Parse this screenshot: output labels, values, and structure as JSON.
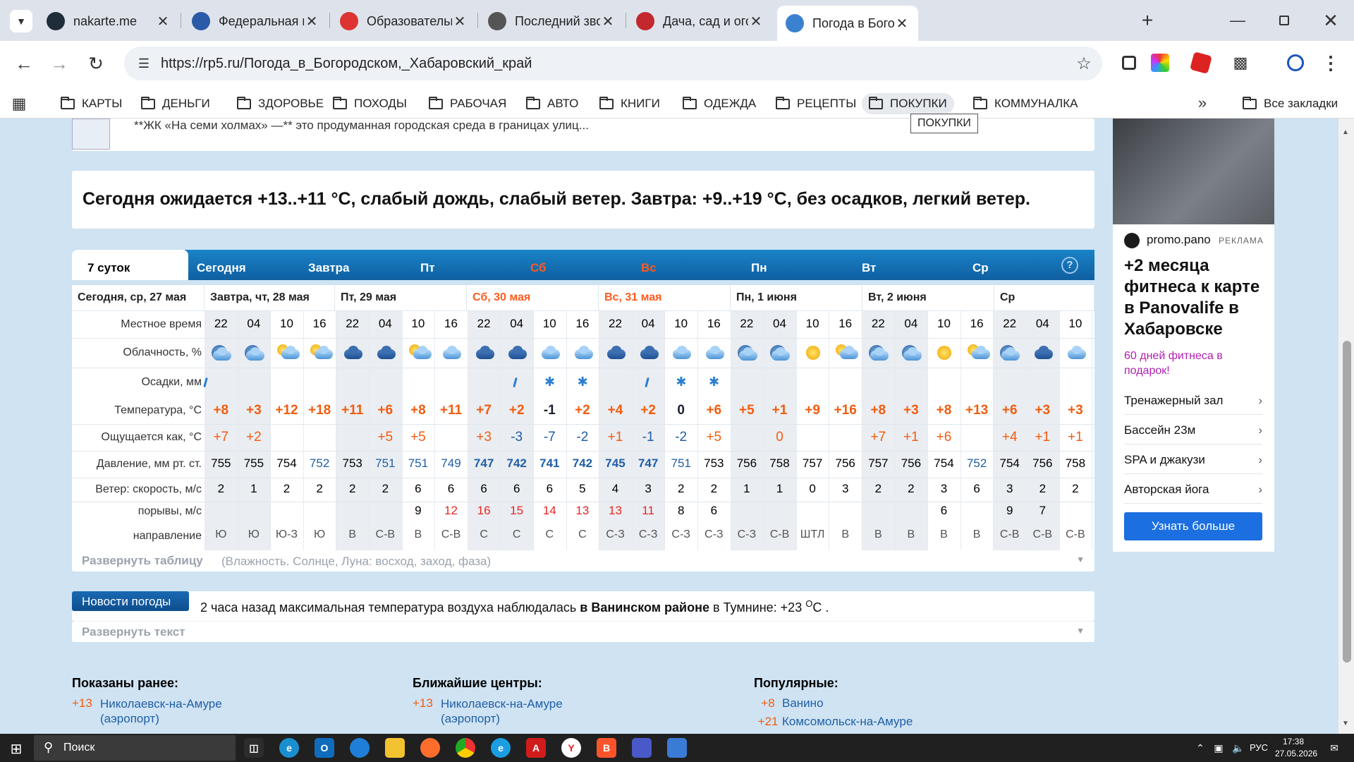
{
  "tabs": [
    {
      "title": "nakarte.me",
      "icon": "nakarte-icon",
      "color": "#1f2d3a"
    },
    {
      "title": "Федеральная налог",
      "icon": "nalog-icon",
      "color": "#2a5aa8"
    },
    {
      "title": "Образовательные п",
      "icon": "edu-icon",
      "color": "#d33"
    },
    {
      "title": "Последний звонок",
      "icon": "globe-icon",
      "color": "#555"
    },
    {
      "title": "Дача, сад и огород",
      "icon": "dacha-icon",
      "color": "#c2282d"
    },
    {
      "title": "Погода в Богородс",
      "icon": "rp5-icon",
      "color": "#3a82d0"
    }
  ],
  "url": "https://rp5.ru/Погода_в_Богородском,_Хабаровский_край",
  "bookmarks": [
    "КАРТЫ",
    "ДЕНЬГИ",
    "ЗДОРОВЬЕ",
    "ПОХОДЫ",
    "РАБОЧАЯ",
    "АВТО",
    "КНИГИ",
    "ОДЕЖДА",
    "РЕЦЕПТЫ",
    "ПОКУПКИ",
    "КОММУНАЛКА"
  ],
  "all_bookmarks": "Все закладки",
  "tooltip": "ПОКУПКИ",
  "ad_top_text": "**ЖК «На семи холмах» —** это продуманная городская среда в границах улиц...",
  "summary": "Сегодня ожидается +13..+11 °C, слабый дождь, слабый ветер. Завтра: +9..+19 °C, без осадков, легкий ветер.",
  "forecast_tabs": [
    {
      "label": "7 суток",
      "weekend": false
    },
    {
      "label": "Сегодня",
      "weekend": false
    },
    {
      "label": "Завтра",
      "weekend": false
    },
    {
      "label": "Пт",
      "weekend": false
    },
    {
      "label": "Сб",
      "weekend": true
    },
    {
      "label": "Вс",
      "weekend": true
    },
    {
      "label": "Пн",
      "weekend": false
    },
    {
      "label": "Вт",
      "weekend": false
    },
    {
      "label": "Ср",
      "weekend": false
    }
  ],
  "help_icon": "?",
  "day_heads": [
    {
      "label": "Сегодня, ср, 27 мая",
      "cols": 1,
      "weekend": false
    },
    {
      "label": "Завтра, чт, 28 мая",
      "cols": 4,
      "weekend": false
    },
    {
      "label": "Пт, 29 мая",
      "cols": 4,
      "weekend": false
    },
    {
      "label": "Сб, 30 мая",
      "cols": 4,
      "weekend": true
    },
    {
      "label": "Вс, 31 мая",
      "cols": 4,
      "weekend": true
    },
    {
      "label": "Пн, 1 июня",
      "cols": 4,
      "weekend": false
    },
    {
      "label": "Вт, 2 июня",
      "cols": 4,
      "weekend": false
    },
    {
      "label": "Ср",
      "cols": 2,
      "weekend": false
    }
  ],
  "row_labels": {
    "time": "Местное время",
    "clouds": "Облачность, %",
    "precip": "Осадки, мм",
    "temp": "Температура, °C",
    "feels": "Ощущается как, °C",
    "pressure": "Давление, мм рт. ст.",
    "wind_speed": "Ветер: скорость, м/с",
    "gusts": "порывы, м/с",
    "direction": "направление"
  },
  "hours": [
    "22",
    "04",
    "10",
    "16",
    "22",
    "04",
    "10",
    "16",
    "22",
    "04",
    "10",
    "16",
    "22",
    "04",
    "10",
    "16",
    "22",
    "04",
    "10",
    "16",
    "22",
    "04",
    "10",
    "16",
    "22",
    "04",
    "10"
  ],
  "clouds": [
    "moon-cloud",
    "moon-cloud",
    "sun-cloud",
    "sun-cloud",
    "overcast",
    "overcast",
    "sun-cloud",
    "cloudy",
    "overcast",
    "overcast",
    "cloudy",
    "cloudy",
    "overcast",
    "overcast",
    "cloudy",
    "cloudy",
    "moon-cloud",
    "moon-cloud",
    "sun",
    "sun-cloud",
    "moon-cloud",
    "moon-cloud",
    "sun",
    "sun-cloud",
    "moon-cloud",
    "overcast",
    "cloudy"
  ],
  "precip": [
    "rain",
    "",
    "",
    "",
    "",
    "",
    "",
    "",
    "",
    "rain",
    "snow",
    "snow",
    "",
    "rain",
    "snow",
    "snow",
    "",
    "",
    "",
    "",
    "",
    "",
    "",
    "",
    "",
    "",
    ""
  ],
  "temps": [
    "+8",
    "+3",
    "+12",
    "+18",
    "+11",
    "+6",
    "+8",
    "+11",
    "+7",
    "+2",
    "-1",
    "+2",
    "+4",
    "+2",
    "0",
    "+6",
    "+5",
    "+1",
    "+9",
    "+16",
    "+8",
    "+3",
    "+8",
    "+13",
    "+6",
    "+3",
    "+3"
  ],
  "feels": [
    "+7",
    "+2",
    "",
    "",
    "",
    "+5",
    "+5",
    "",
    "+3",
    "-3",
    "-7",
    "-2",
    "+1",
    "-1",
    "-2",
    "+5",
    "",
    "0",
    "",
    "",
    "+7",
    "+1",
    "+6",
    "",
    "+4",
    "+1",
    "+1"
  ],
  "pressure": [
    "755",
    "755",
    "754",
    "752",
    "753",
    "751",
    "751",
    "749",
    "747",
    "742",
    "741",
    "742",
    "745",
    "747",
    "751",
    "753",
    "756",
    "758",
    "757",
    "756",
    "757",
    "756",
    "754",
    "752",
    "754",
    "756",
    "758"
  ],
  "pressure_style": [
    "n",
    "n",
    "n",
    "b",
    "n",
    "b",
    "b",
    "b",
    "h",
    "h",
    "h",
    "h",
    "h",
    "h",
    "b",
    "n",
    "n",
    "n",
    "n",
    "n",
    "n",
    "n",
    "n",
    "b",
    "n",
    "n",
    "n"
  ],
  "wind": [
    "2",
    "1",
    "2",
    "2",
    "2",
    "2",
    "6",
    "6",
    "6",
    "6",
    "6",
    "5",
    "4",
    "3",
    "2",
    "2",
    "1",
    "1",
    "0",
    "3",
    "2",
    "2",
    "3",
    "6",
    "3",
    "2",
    "2"
  ],
  "gusts": [
    "",
    "",
    "",
    "",
    "",
    "",
    "9",
    "12",
    "16",
    "15",
    "14",
    "13",
    "13",
    "11",
    "8",
    "6",
    "",
    "",
    "",
    "",
    "",
    "",
    "6",
    "",
    "9",
    "7",
    ""
  ],
  "directions": [
    "Ю",
    "Ю",
    "Ю-З",
    "Ю",
    "В",
    "С-В",
    "В",
    "С-В",
    "С",
    "С",
    "С",
    "С",
    "С-З",
    "С-З",
    "С-З",
    "С-З",
    "С-З",
    "С-В",
    "ШТЛ",
    "В",
    "В",
    "В",
    "В",
    "В",
    "С-В",
    "С-В",
    "С-В"
  ],
  "expand_table": "Развернуть таблицу",
  "expand_table_hint": "(Влажность. Солнце, Луна: восход, заход, фаза)",
  "news_badge": "Новости погоды",
  "news_pre": "2 часа назад максимальная температура воздуха наблюдалась ",
  "news_bold": "в Ванинском районе",
  "news_post": " в Тумнине: +23 ",
  "news_unit_sup": "O",
  "news_unit": "C .",
  "expand_text": "Развернуть текст",
  "shown_before": {
    "title": "Показаны ранее:",
    "items": [
      {
        "temp": "+13",
        "name": "Николаевск-на-Амуре (аэропорт)"
      }
    ]
  },
  "nearest": {
    "title": "Ближайшие центры:",
    "items": [
      {
        "temp": "+13",
        "name": "Николаевск-на-Амуре (аэропорт)"
      }
    ]
  },
  "popular": {
    "title": "Популярные:",
    "items": [
      {
        "temp": "+8",
        "name": "Ванино"
      },
      {
        "temp": "+21",
        "name": "Комсомольск-на-Амуре"
      }
    ]
  },
  "ad": {
    "brand": "promo.pano",
    "ad_label": "РЕКЛАМА",
    "headline": "+2 месяца фитнеса к карте в Panovalife в Хабаровске",
    "sub": "60 дней фитнеса в подарок!",
    "links": [
      "Тренажерный зал",
      "Бассейн 23м",
      "SPA и джакузи",
      "Авторская йога"
    ],
    "button": "Узнать больше"
  },
  "taskbar": {
    "search": "Поиск",
    "lang": "РУС",
    "time": "17:38",
    "date": "27.05.2026"
  },
  "colors": {
    "accent_blue": "#0f5fa0",
    "weekend": "#ff5a1e",
    "temp_orange": "#f25c0f",
    "link": "#1f5fa6"
  }
}
